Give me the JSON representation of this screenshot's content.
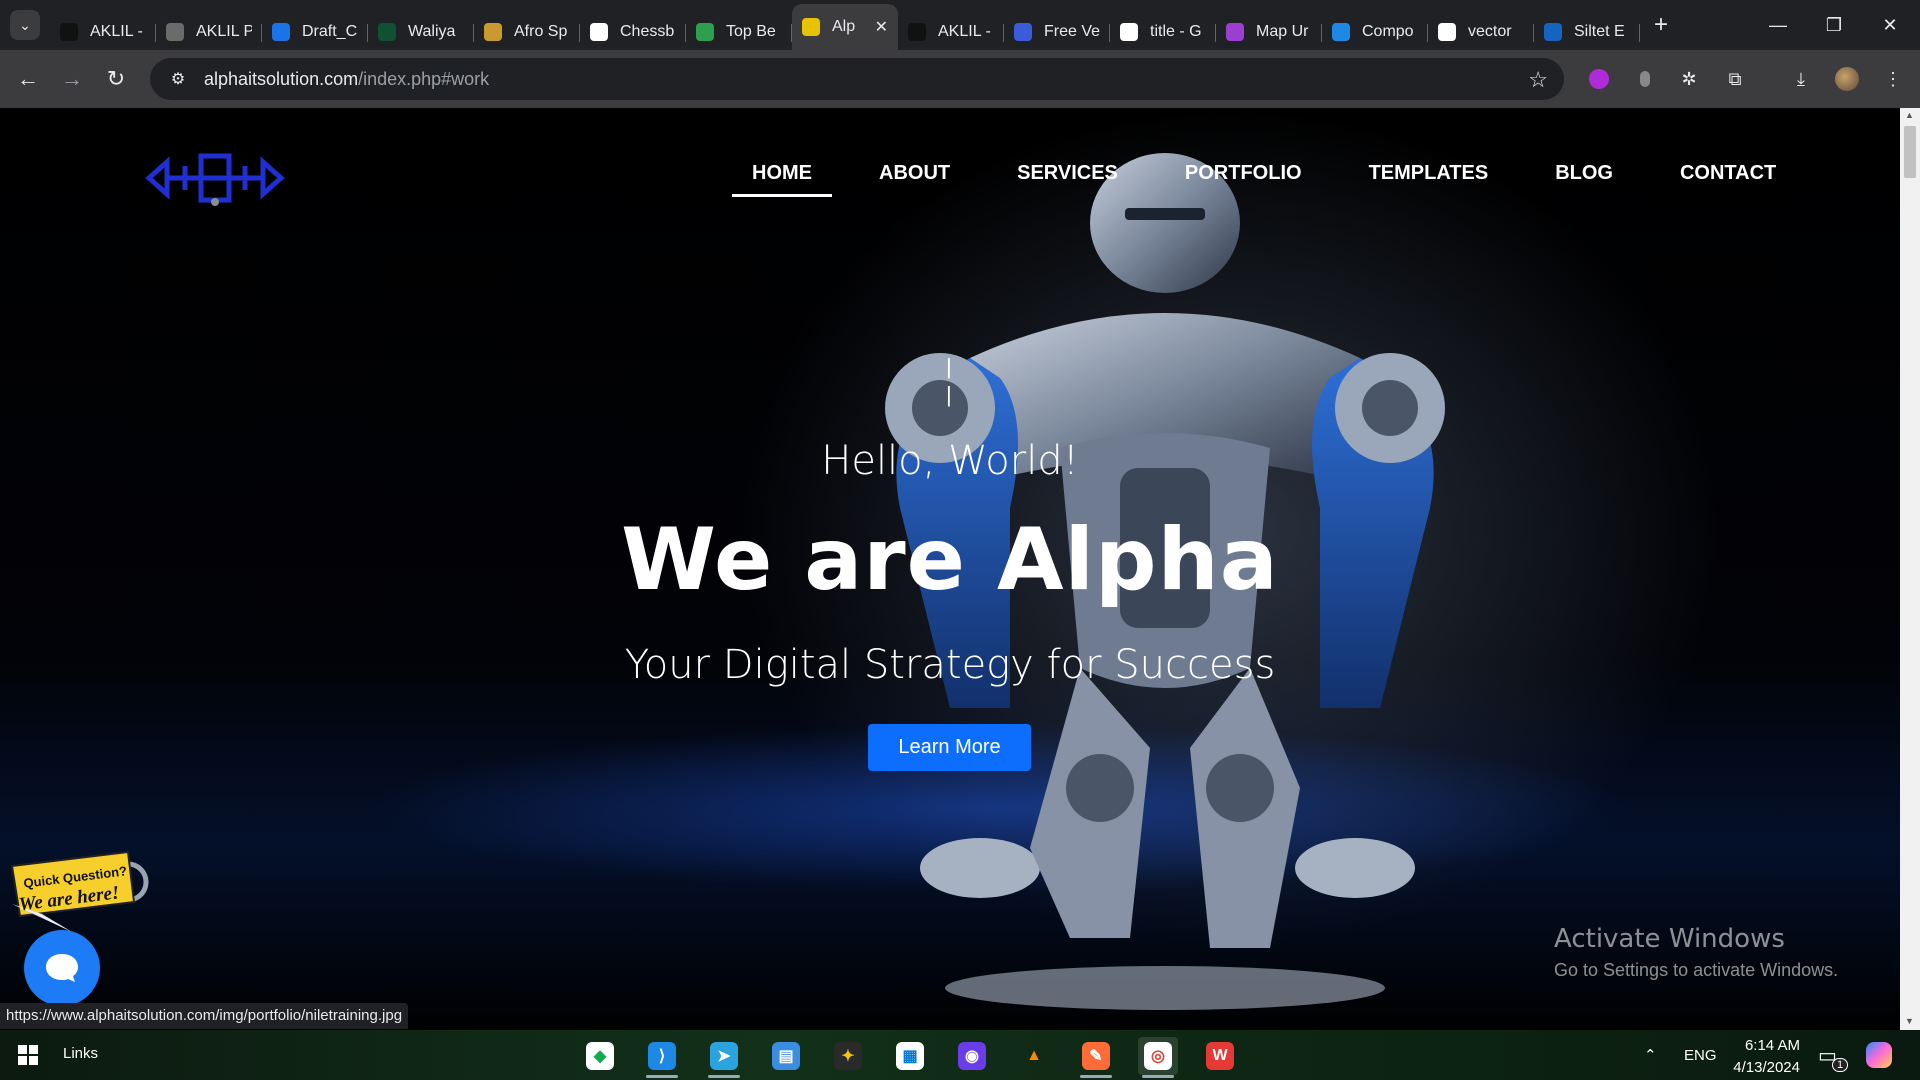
{
  "browser": {
    "tabs": [
      {
        "title": "AKLIL -",
        "favicon_color": "#111111",
        "icon": "aklil-logo-icon"
      },
      {
        "title": "AKLIL P",
        "favicon_color": "#6b6b6b",
        "icon": "globe-icon"
      },
      {
        "title": "Draft_C",
        "favicon_color": "#1a73e8",
        "icon": "dropbox-icon"
      },
      {
        "title": "Waliya",
        "favicon_color": "#0f5132",
        "icon": "waliya-icon"
      },
      {
        "title": "Afro Sp",
        "favicon_color": "#c99a2e",
        "icon": "afro-sports-icon"
      },
      {
        "title": "Chessb",
        "favicon_color": "#ffffff",
        "icon": "chess-piece-icon"
      },
      {
        "title": "Top Be",
        "favicon_color": "#2e9e4f",
        "icon": "earth-icon"
      },
      {
        "title": "Alp",
        "favicon_color": "#e6c200",
        "icon": "alpha-robot-icon",
        "active": true
      },
      {
        "title": "AKLIL -",
        "favicon_color": "#111111",
        "icon": "aklil-logo-icon"
      },
      {
        "title": "Free Ve",
        "favicon_color": "#3b5bdb",
        "icon": "free-vector-icon"
      },
      {
        "title": "title - G",
        "favicon_color": "#ffffff",
        "icon": "google-icon"
      },
      {
        "title": "Map Ur",
        "favicon_color": "#9b3fd1",
        "icon": "chat-ai-icon"
      },
      {
        "title": "Compo",
        "favicon_color": "#1e88e5",
        "icon": "component-icon"
      },
      {
        "title": "vector",
        "favicon_color": "#ffffff",
        "icon": "google-icon"
      },
      {
        "title": "Siltet E",
        "favicon_color": "#1565c0",
        "icon": "siltet-icon"
      }
    ],
    "url_host": "alphaitsolution.com",
    "url_path": "/index.php#work",
    "status_url": "https://www.alphaitsolution.com/img/portfolio/niletraining.jpg"
  },
  "site": {
    "nav": [
      "HOME",
      "ABOUT",
      "SERVICES",
      "PORTFOLIO",
      "TEMPLATES",
      "BLOG",
      "CONTACT"
    ],
    "active_nav": "HOME",
    "typed_lines": [
      "|",
      ".",
      "|"
    ],
    "hello": "Hello, World!",
    "title": "We are Alpha",
    "subtitle": "Your Digital Strategy for Success",
    "cta": "Learn More",
    "quick_question_top": "Quick Question?",
    "quick_question_bottom": "We are here!"
  },
  "windows_watermark": {
    "line1": "Activate Windows",
    "line2": "Go to Settings to activate Windows."
  },
  "taskbar": {
    "links_label": "Links",
    "apps": [
      {
        "name": "mongodb-compass-icon",
        "color": "#ffffff",
        "glyph": "◆",
        "fg": "#13aa52"
      },
      {
        "name": "vscode-icon",
        "color": "#1e88e5",
        "glyph": "⟩",
        "fg": "#ffffff",
        "running": true
      },
      {
        "name": "telegram-icon",
        "color": "#2aa3df",
        "glyph": "➤",
        "fg": "#ffffff",
        "running": true
      },
      {
        "name": "file-explorer-icon",
        "color": "#3a8de0",
        "glyph": "▤",
        "fg": "#ffffff"
      },
      {
        "name": "git-kraken-icon",
        "color": "#2a2a2a",
        "glyph": "✦",
        "fg": "#f1c40f"
      },
      {
        "name": "microsoft-store-icon",
        "color": "#ffffff",
        "glyph": "▦",
        "fg": "#0078d4"
      },
      {
        "name": "podcast-app-icon",
        "color": "#6a3de8",
        "glyph": "◉",
        "fg": "#ffffff"
      },
      {
        "name": "vlc-icon",
        "color": "#00000000",
        "glyph": "▲",
        "fg": "#ff8800"
      },
      {
        "name": "postman-icon",
        "color": "#ff6c37",
        "glyph": "✎",
        "fg": "#ffffff",
        "running": true
      },
      {
        "name": "chrome-icon",
        "color": "#ffffff",
        "glyph": "◎",
        "fg": "#db4437",
        "running": true,
        "active": true
      },
      {
        "name": "wps-office-icon",
        "color": "#e53935",
        "glyph": "W",
        "fg": "#ffffff"
      }
    ],
    "language": "ENG",
    "time": "6:14 AM",
    "date": "4/13/2024",
    "notification_count": "1"
  }
}
